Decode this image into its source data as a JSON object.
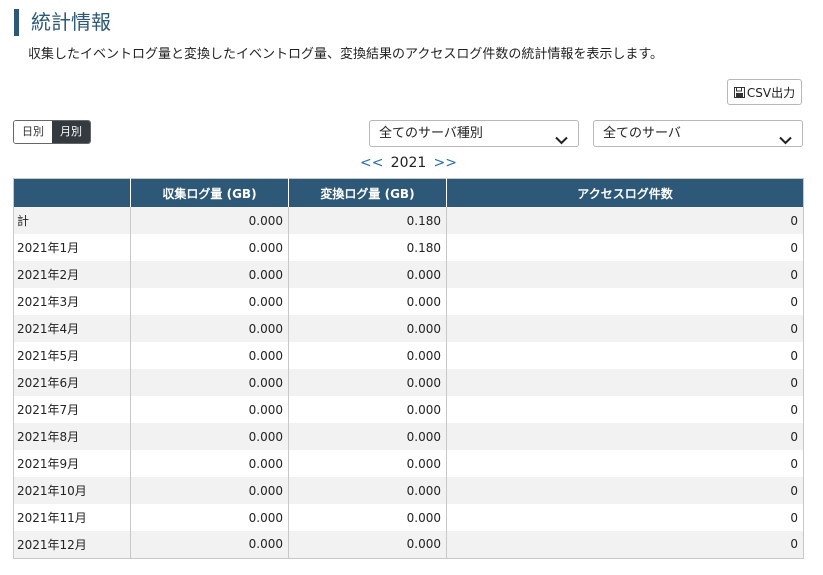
{
  "page": {
    "title": "統計情報",
    "description": "収集したイベントログ量と変換したイベントログ量、変換結果のアクセスログ件数の統計情報を表示します。"
  },
  "toolbar": {
    "csv_label": "CSV出力",
    "csv_icon": "save-icon"
  },
  "period_toggle": {
    "options": [
      "日別",
      "月別"
    ],
    "selected": "月別"
  },
  "filters": {
    "server_type": "全てのサーバ種別",
    "server": "全てのサーバ"
  },
  "year_nav": {
    "prev": "<<",
    "year": "2021",
    "next": ">>"
  },
  "table": {
    "headers": [
      "",
      "収集ログ量 (GB)",
      "変換ログ量 (GB)",
      "アクセスログ件数"
    ],
    "rows": [
      [
        "計",
        "0.000",
        "0.180",
        "0"
      ],
      [
        "2021年1月",
        "0.000",
        "0.180",
        "0"
      ],
      [
        "2021年2月",
        "0.000",
        "0.000",
        "0"
      ],
      [
        "2021年3月",
        "0.000",
        "0.000",
        "0"
      ],
      [
        "2021年4月",
        "0.000",
        "0.000",
        "0"
      ],
      [
        "2021年5月",
        "0.000",
        "0.000",
        "0"
      ],
      [
        "2021年6月",
        "0.000",
        "0.000",
        "0"
      ],
      [
        "2021年7月",
        "0.000",
        "0.000",
        "0"
      ],
      [
        "2021年8月",
        "0.000",
        "0.000",
        "0"
      ],
      [
        "2021年9月",
        "0.000",
        "0.000",
        "0"
      ],
      [
        "2021年10月",
        "0.000",
        "0.000",
        "0"
      ],
      [
        "2021年11月",
        "0.000",
        "0.000",
        "0"
      ],
      [
        "2021年12月",
        "0.000",
        "0.000",
        "0"
      ]
    ]
  },
  "colors": {
    "accent": "#2d5878",
    "link": "#2a6db0",
    "toggle_active": "#333a40"
  }
}
